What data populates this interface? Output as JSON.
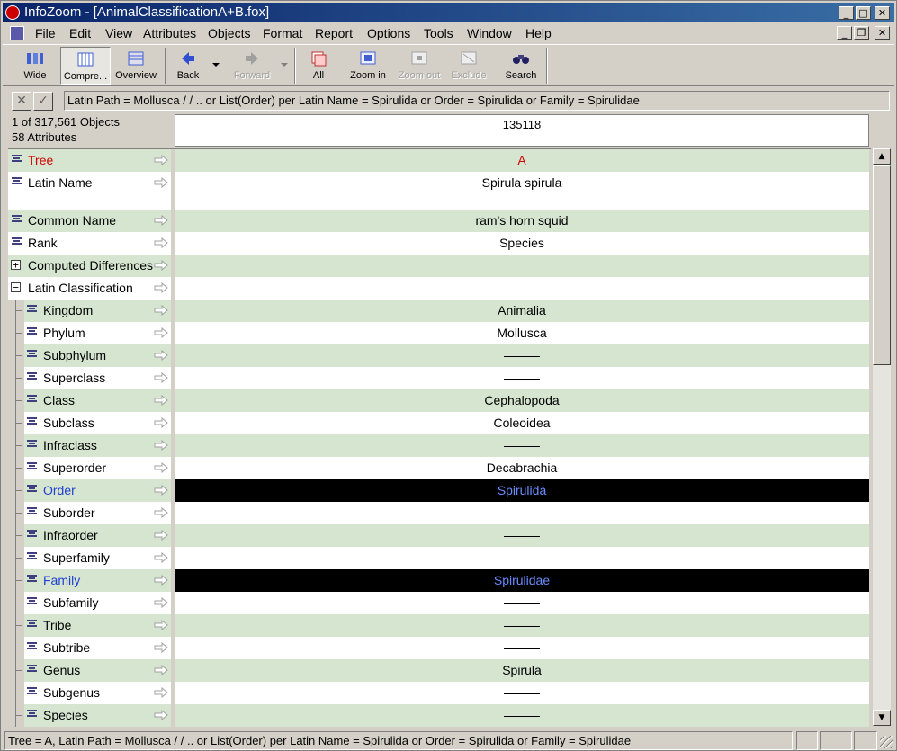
{
  "window": {
    "title": "InfoZoom - [AnimalClassificationA+B.fox]"
  },
  "menu": [
    "File",
    "Edit",
    "View",
    "Attributes",
    "Objects",
    "Format",
    "Report",
    "Options",
    "Tools",
    "Window",
    "Help"
  ],
  "toolbar": {
    "wide": "Wide",
    "compress": "Compre...",
    "overview": "Overview",
    "back": "Back",
    "forward": "Forward",
    "all": "All",
    "zoom_in": "Zoom in",
    "zoom_out": "Zoom out",
    "exclude": "Exclude",
    "search": "Search"
  },
  "filter": {
    "expression": "Latin Path = Mollusca / / .. or List(Order) per Latin Name = Spirulida or Order = Spirulida or Family = Spirulidae"
  },
  "info": {
    "objects": "1 of 317,561 Objects",
    "attributes": "58 Attributes"
  },
  "column": {
    "header": "135118"
  },
  "rows": [
    {
      "label": "Tree",
      "value": "A"
    },
    {
      "label": "Latin Name",
      "value": "Spirula spirula"
    },
    {
      "label": "Common Name",
      "value": "ram's horn squid"
    },
    {
      "label": "Rank",
      "value": "Species"
    },
    {
      "label": "Computed Differences",
      "value": ""
    },
    {
      "label": "Latin Classification",
      "value": ""
    },
    {
      "label": "Kingdom",
      "value": "Animalia"
    },
    {
      "label": "Phylum",
      "value": "Mollusca"
    },
    {
      "label": "Subphylum",
      "value": ""
    },
    {
      "label": "Superclass",
      "value": ""
    },
    {
      "label": "Class",
      "value": "Cephalopoda"
    },
    {
      "label": "Subclass",
      "value": "Coleoidea"
    },
    {
      "label": "Infraclass",
      "value": ""
    },
    {
      "label": "Superorder",
      "value": "Decabrachia"
    },
    {
      "label": "Order",
      "value": "Spirulida"
    },
    {
      "label": "Suborder",
      "value": ""
    },
    {
      "label": "Infraorder",
      "value": ""
    },
    {
      "label": "Superfamily",
      "value": ""
    },
    {
      "label": "Family",
      "value": "Spirulidae"
    },
    {
      "label": "Subfamily",
      "value": ""
    },
    {
      "label": "Tribe",
      "value": ""
    },
    {
      "label": "Subtribe",
      "value": ""
    },
    {
      "label": "Genus",
      "value": "Spirula"
    },
    {
      "label": "Subgenus",
      "value": ""
    },
    {
      "label": "Species",
      "value": ""
    }
  ],
  "status": {
    "text": "Tree = A, Latin Path = Mollusca / / .. or List(Order) per Latin Name = Spirulida or Order = Spirulida or Family = Spirulidae"
  }
}
